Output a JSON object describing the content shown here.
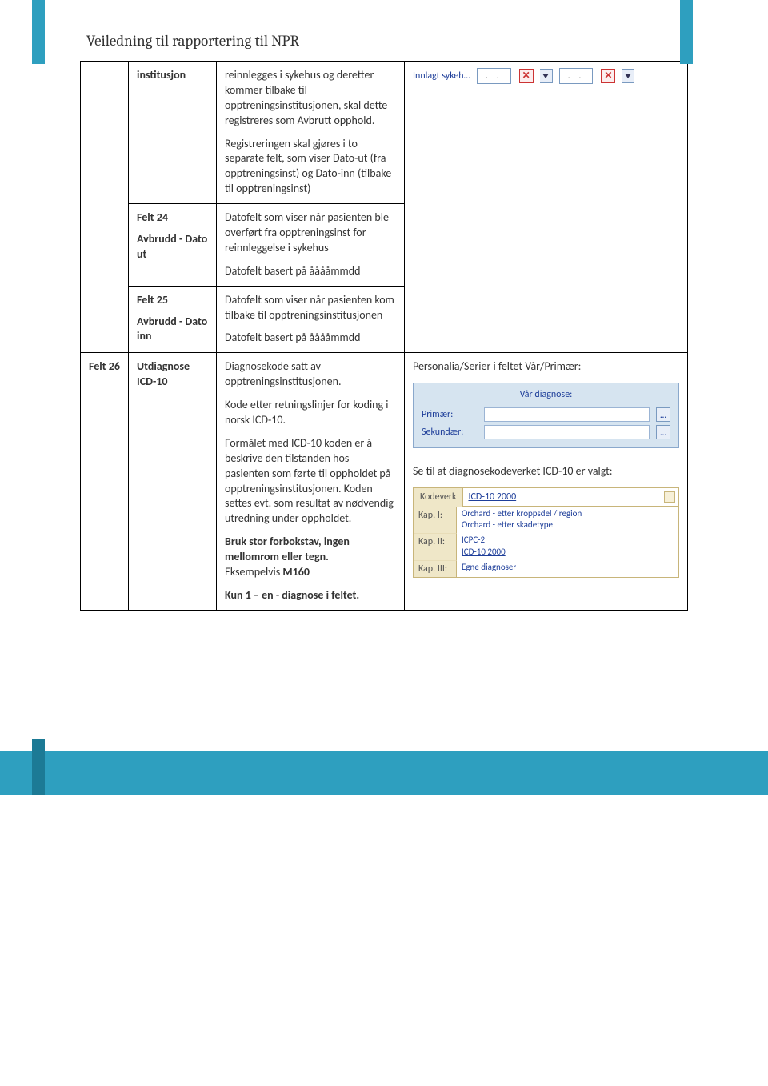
{
  "header": {
    "title": "Veiledning til rapportering til NPR"
  },
  "rows": {
    "r1": {
      "name": "institusjon",
      "desc_p1": "reinnlegges i sykehus og deretter kommer tilbake til opptreningsinstitusjonen, skal dette registreres som Avbrutt opphold.",
      "desc_p2": "Registreringen skal gjøres i to separate felt, som viser Dato-ut (fra opptreningsinst) og Dato-inn (tilbake til opptreningsinst)"
    },
    "widget1": {
      "label": "Innlagt sykeh…",
      "date_placeholder": "  .     .",
      "x": "✕"
    },
    "r2": {
      "name_l1": "Felt 24",
      "name_l2": "Avbrudd - Dato ut",
      "desc_p1": "Datofelt som viser når pasienten ble overført fra opptreningsinst for reinnleggelse i sykehus",
      "desc_p2": "Datofelt basert på ååååmmdd"
    },
    "r3": {
      "name_l1": "Felt 25",
      "name_l2": "Avbrudd - Dato inn",
      "desc_p1": "Datofelt som viser når pasienten kom tilbake til opptreningsinstitusjonen",
      "desc_p2": "Datofelt basert på ååååmmdd"
    },
    "r4": {
      "idx": "Felt 26",
      "name": "Utdiagnose ICD-10",
      "desc_p1": "Diagnosekode satt av opptreningsinstitusjonen.",
      "desc_p2": "Kode etter retningslinjer for koding i norsk ICD-10.",
      "desc_p3": "Formålet med ICD-10 koden er å beskrive den tilstanden hos pasienten som førte til oppholdet på opptreningsinstitusjonen. Koden settes evt. som resultat av nødvendig utredning under oppholdet.",
      "desc_p4a": "Bruk stor forbokstav, ingen mellomrom eller tegn.",
      "desc_p4b": "Eksempelvis ",
      "desc_p4c": "M160",
      "desc_p5": "Kun 1 – en - diagnose i feltet.",
      "right_p1": "Personalia/Serier i feltet Vår/Primær:",
      "right_p2": "Se til at diagnosekodeverket ICD-10 er valgt:"
    },
    "diag": {
      "title": "Vår diagnose:",
      "primary": "Primær:",
      "secondary": "Sekundær:",
      "ell": "..."
    },
    "kode": {
      "label": "Kodeverk",
      "selected": "ICD-10  2000",
      "kap1": "Kap. I:",
      "kap1_opt1": "Orchard - etter kroppsdel / region",
      "kap1_opt2": "Orchard - etter skadetype",
      "kap2": "Kap. II:",
      "kap2_opt": "ICPC-2",
      "kap3": "Kap. III:",
      "kap3_opt1": "ICD-10  2000",
      "kap3_opt2": "Egne diagnoser"
    }
  }
}
